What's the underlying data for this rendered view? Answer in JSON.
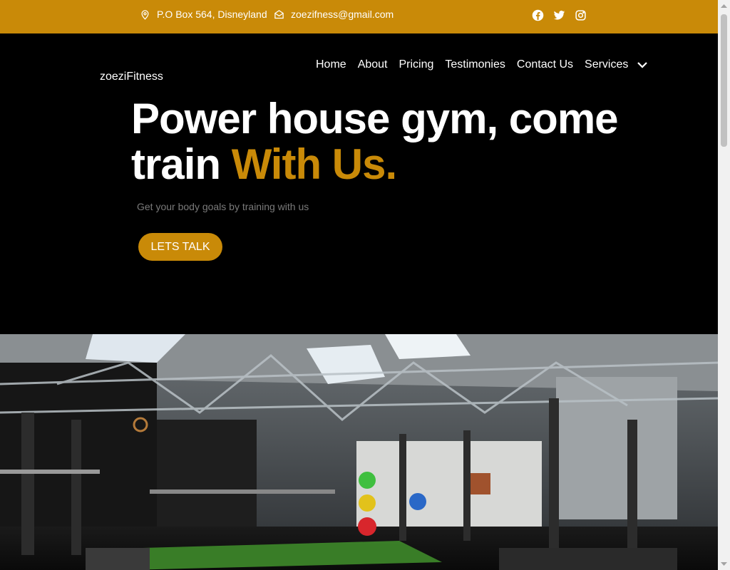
{
  "topbar": {
    "address": "P.O Box 564, Disneyland",
    "email": "zoezifness@gmail.com",
    "social": [
      "facebook-icon",
      "twitter-icon",
      "instagram-icon"
    ],
    "color": "#c98a08"
  },
  "nav": {
    "logo": "zoeziFitness",
    "items": [
      "Home",
      "About",
      "Pricing",
      "Testimonies",
      "Contact Us",
      "Services"
    ]
  },
  "hero": {
    "title_line1": "Power house gym, come",
    "title_line2_plain": "train ",
    "title_line2_accent": "With Us.",
    "subtitle": "Get your body goals by training with us",
    "cta": "LETS TALK"
  }
}
